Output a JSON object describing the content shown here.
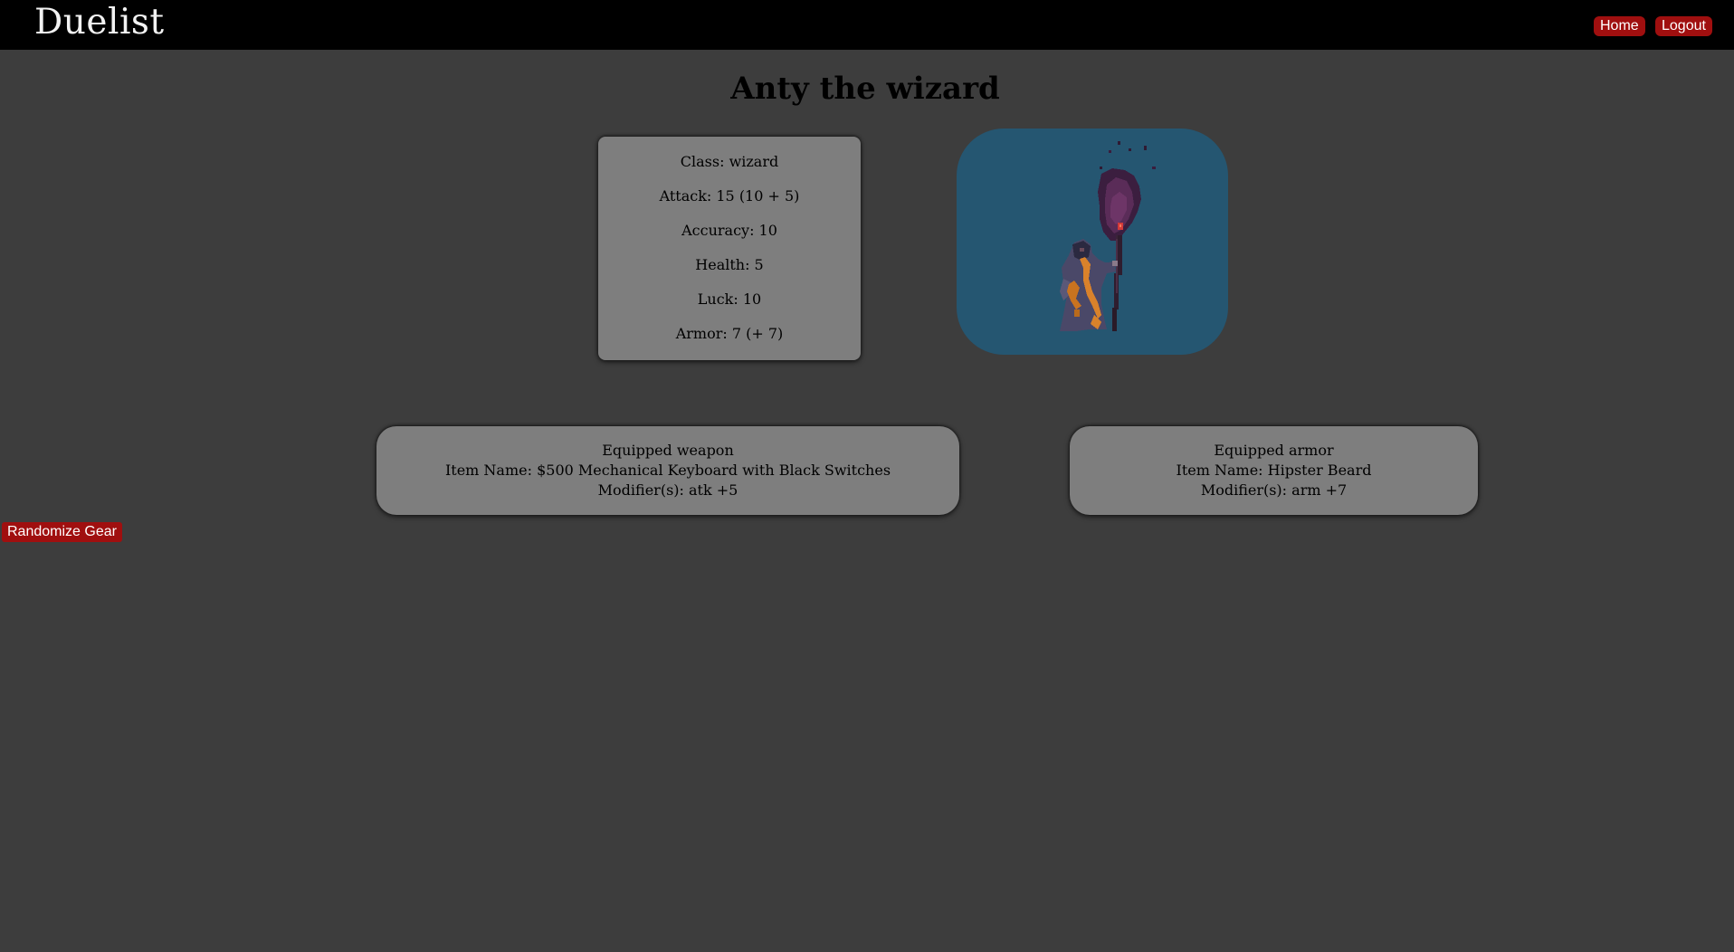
{
  "navbar": {
    "brand": "Duelist",
    "home_label": "Home",
    "logout_label": "Logout"
  },
  "character": {
    "title": "Anty the wizard",
    "stats": {
      "class": "Class: wizard",
      "attack": "Attack: 15 (10 + 5)",
      "accuracy": "Accuracy: 10",
      "health": "Health: 5",
      "luck": "Luck: 10",
      "armor": "Armor: 7 (+ 7)"
    },
    "portrait_icon": "wizard-sprite-icon"
  },
  "gear": {
    "weapon": {
      "heading": "Equipped weapon",
      "name": "Item Name: $500 Mechanical Keyboard with Black Switches",
      "modifier": "Modifier(s): atk +5"
    },
    "armor": {
      "heading": "Equipped armor",
      "name": "Item Name: Hipster Beard",
      "modifier": "Modifier(s): arm +7"
    }
  },
  "actions": {
    "randomize_label": "Randomize Gear"
  },
  "colors": {
    "background": "#3d3d3d",
    "navbar": "#000000",
    "accent_button": "#a00f0f",
    "card": "#7e7e7e",
    "portrait_bg": "#255671"
  }
}
